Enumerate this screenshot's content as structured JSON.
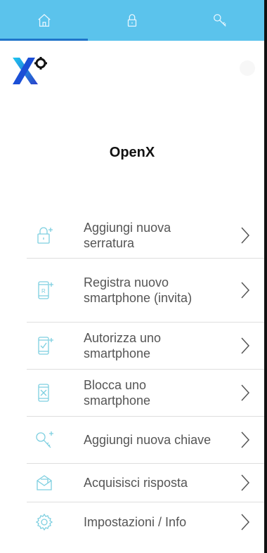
{
  "app": {
    "title": "OpenX"
  },
  "tabs": [
    {
      "name": "home",
      "icon": "home-icon",
      "active": true
    },
    {
      "name": "locks",
      "icon": "lock-icon",
      "active": false
    },
    {
      "name": "keys",
      "icon": "key-icon",
      "active": false
    }
  ],
  "menu": [
    {
      "label": "Aggiungi nuova serratura",
      "icon": "add-lock-icon"
    },
    {
      "label": "Registra nuovo smartphone (invita)",
      "icon": "register-phone-icon"
    },
    {
      "label": "Autorizza uno smartphone",
      "icon": "authorize-phone-icon"
    },
    {
      "label": "Blocca uno smartphone",
      "icon": "block-phone-icon"
    },
    {
      "label": "Aggiungi nuova chiave",
      "icon": "add-key-icon"
    },
    {
      "label": "Acquisisci risposta",
      "icon": "envelope-icon"
    },
    {
      "label": "Impostazioni / Info",
      "icon": "gear-icon"
    }
  ],
  "colors": {
    "tabbar": "#5bc3ec",
    "active_indicator": "#1f74c9",
    "icon_accent": "#7dcfe0",
    "text": "#555555"
  }
}
